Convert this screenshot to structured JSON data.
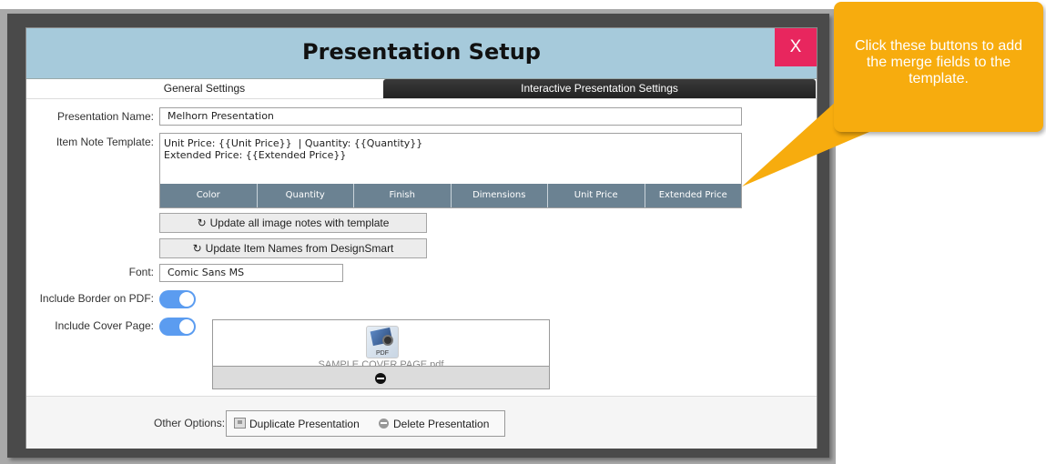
{
  "dialog": {
    "title": "Presentation Setup",
    "close_label": "X",
    "tabs": [
      {
        "label": "General Settings",
        "active": true
      },
      {
        "label": "Interactive Presentation Settings",
        "active": false
      }
    ]
  },
  "form": {
    "presentation_name": {
      "label": "Presentation Name:",
      "value": "Melhorn Presentation"
    },
    "item_note_template": {
      "label": "Item Note Template:",
      "value": "Unit Price: {{Unit Price}}  | Quantity: {{Quantity}}\nExtended Price: {{Extended Price}}"
    },
    "merge_fields": [
      "Color",
      "Quantity",
      "Finish",
      "Dimensions",
      "Unit Price",
      "Extended Price"
    ],
    "update_notes_button": "Update all image notes with template",
    "update_names_button": "Update Item Names from DesignSmart",
    "font": {
      "label": "Font:",
      "value": "Comic Sans MS"
    },
    "include_border": {
      "label": "Include Border on PDF:",
      "enabled": true
    },
    "include_cover": {
      "label": "Include Cover Page:",
      "enabled": true
    },
    "cover_file": {
      "icon_label": "PDF",
      "name": "SAMPLE COVER PAGE.pdf"
    }
  },
  "footer": {
    "other_options_label": "Other Options:",
    "duplicate_label": "Duplicate Presentation",
    "delete_label": "Delete Presentation"
  },
  "callout": {
    "text": "Click these buttons to add the merge fields to the template."
  },
  "colors": {
    "title_bar": "#a6cadb",
    "close_button": "#e8265e",
    "merge_bar": "#6b8292",
    "toggle_on": "#5b9cf0",
    "callout": "#f7ac0e"
  }
}
